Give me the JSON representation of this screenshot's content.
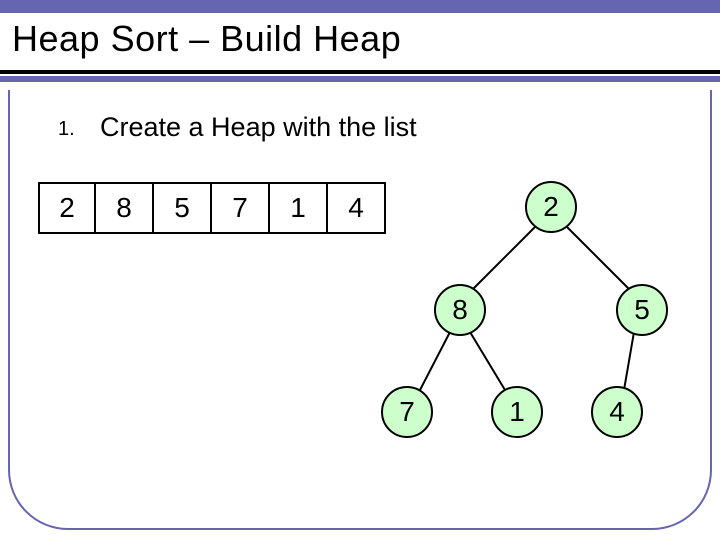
{
  "title": "Heap Sort – Build Heap",
  "step": {
    "num": "1.",
    "text": "Create a Heap with the list"
  },
  "array": [
    "2",
    "8",
    "5",
    "7",
    "1",
    "4"
  ],
  "tree": {
    "root": "2",
    "left": "8",
    "right": "5",
    "ll": "7",
    "lr": "1",
    "rl": "4"
  }
}
